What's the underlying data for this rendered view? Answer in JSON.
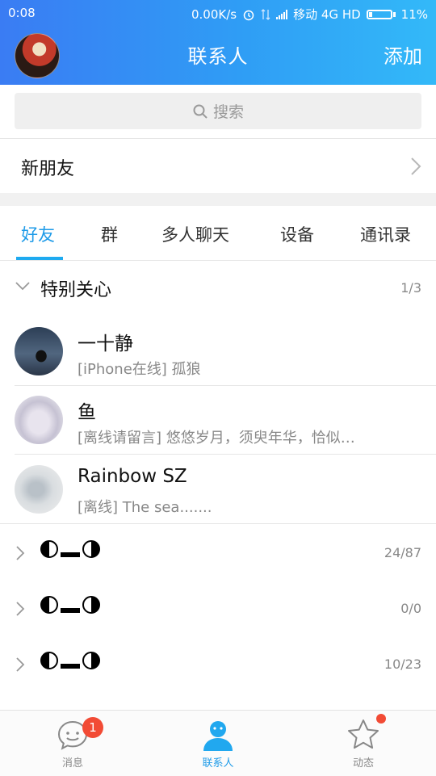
{
  "status": {
    "time": "0:08",
    "speed": "0.00K/s",
    "carrier": "移动 4G HD",
    "battery": "11%"
  },
  "header": {
    "title": "联系人",
    "add_label": "添加"
  },
  "search": {
    "placeholder": "搜索"
  },
  "new_friends": {
    "label": "新朋友"
  },
  "tabs": [
    "好友",
    "群",
    "多人聊天",
    "设备",
    "通讯录"
  ],
  "special_group": {
    "name": "特别关心",
    "count": "1/3"
  },
  "contacts": [
    {
      "name": "一十静",
      "status": "[iPhone在线] 孤狼"
    },
    {
      "name": "鱼",
      "status": "[离线请留言] 悠悠岁月，须臾年华，恰似…"
    },
    {
      "name": "Rainbow SZ",
      "status": "[离线] The  sea......."
    }
  ],
  "groups": [
    {
      "count": "24/87"
    },
    {
      "count": "0/0"
    },
    {
      "count": "10/23"
    }
  ],
  "bottom_nav": {
    "messages": "消息",
    "contacts": "联系人",
    "moments": "动态",
    "messages_badge": "1"
  },
  "colors": {
    "accent": "#1e9be8",
    "header_start": "#3a7cf3",
    "header_end": "#33b9f8",
    "badge": "#f24b35"
  }
}
